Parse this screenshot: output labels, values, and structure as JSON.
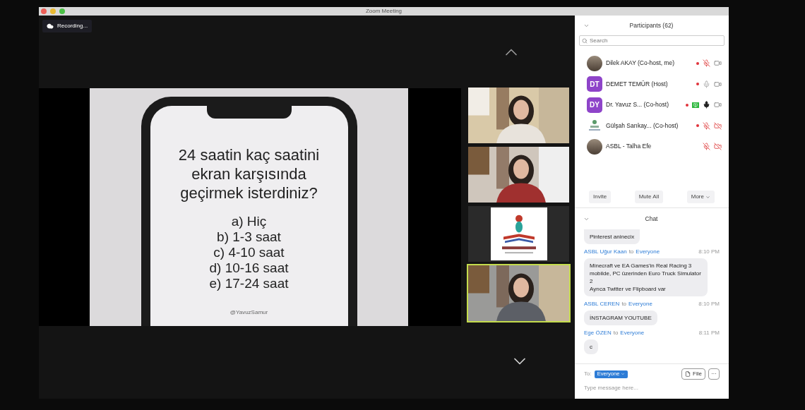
{
  "window": {
    "title": "Zoom Meeting"
  },
  "recording": {
    "label": "Recording..."
  },
  "shared_screen": {
    "question": "24 saatin kaç saatini ekran karşısında geçirmek isterdiniz?",
    "options": [
      "a) Hiç",
      "b) 1-3 saat",
      "c) 4-10 saat",
      "d) 10-16 saat",
      "e) 17-24 saat"
    ],
    "credit": "@YavuzSamur"
  },
  "video_tiles": [
    {
      "kind": "camera",
      "speaking": false
    },
    {
      "kind": "camera",
      "speaking": false
    },
    {
      "kind": "logo",
      "speaking": false
    },
    {
      "kind": "camera",
      "speaking": true
    }
  ],
  "participants": {
    "title": "Participants (62)",
    "search": {
      "placeholder": "Search"
    },
    "items": [
      {
        "name": "Dilek AKAY (Co-host, me)",
        "recording": true,
        "sharing": false,
        "muted": true,
        "video_off": false
      },
      {
        "name": "DEMET TEMÜR (Host)",
        "avatar": {
          "kind": "initials",
          "initials": "DT",
          "color": "#8e44c9"
        },
        "recording": true,
        "sharing": false,
        "speaking": false,
        "muted": false,
        "video_off": false
      },
      {
        "name": "Dr. Yavuz S... (Co-host)",
        "avatar": {
          "kind": "initials",
          "initials": "DY",
          "color": "#8e44c9"
        },
        "recording": true,
        "sharing": true,
        "speaking": true,
        "muted": false,
        "video_off": false
      },
      {
        "name": "Gülşah Sarıkay...  (Co-host)",
        "avatar": {
          "kind": "logo"
        },
        "recording": true,
        "sharing": false,
        "muted": true,
        "video_off": true
      },
      {
        "name": "ASBL - Talha Efe",
        "recording": false,
        "sharing": false,
        "muted": true,
        "video_off": true
      }
    ],
    "buttons": [
      "Invite",
      "Mute All",
      "More"
    ]
  },
  "chat": {
    "title": "Chat",
    "messages": [
      {
        "lines": [
          "Pinterest aninecix"
        ]
      },
      {
        "sender": "ASBL Uğur Kaan",
        "connector": "to",
        "recipient": "Everyone",
        "time": "8:10 PM",
        "lines": [
          "Minecraft ve EA Games'in Real Racing 3 mobilde, PC üzerinden Euro Truck Simulator 2",
          "Ayrıca Twitter ve Flipboard var"
        ]
      },
      {
        "sender": "ASBL CEREN",
        "connector": "to",
        "recipient": "Everyone",
        "time": "8:10 PM",
        "lines": [
          "İNSTAGRAM YOUTUBE"
        ]
      },
      {
        "sender": "Ege ÖZEN",
        "connector": "to",
        "recipient": "Everyone",
        "time": "8:11 PM",
        "lines": [
          "c"
        ]
      }
    ],
    "to_label": "To:",
    "recipient": "Everyone",
    "file_button": "File",
    "more_button": "···",
    "placeholder": "Type message here..."
  }
}
